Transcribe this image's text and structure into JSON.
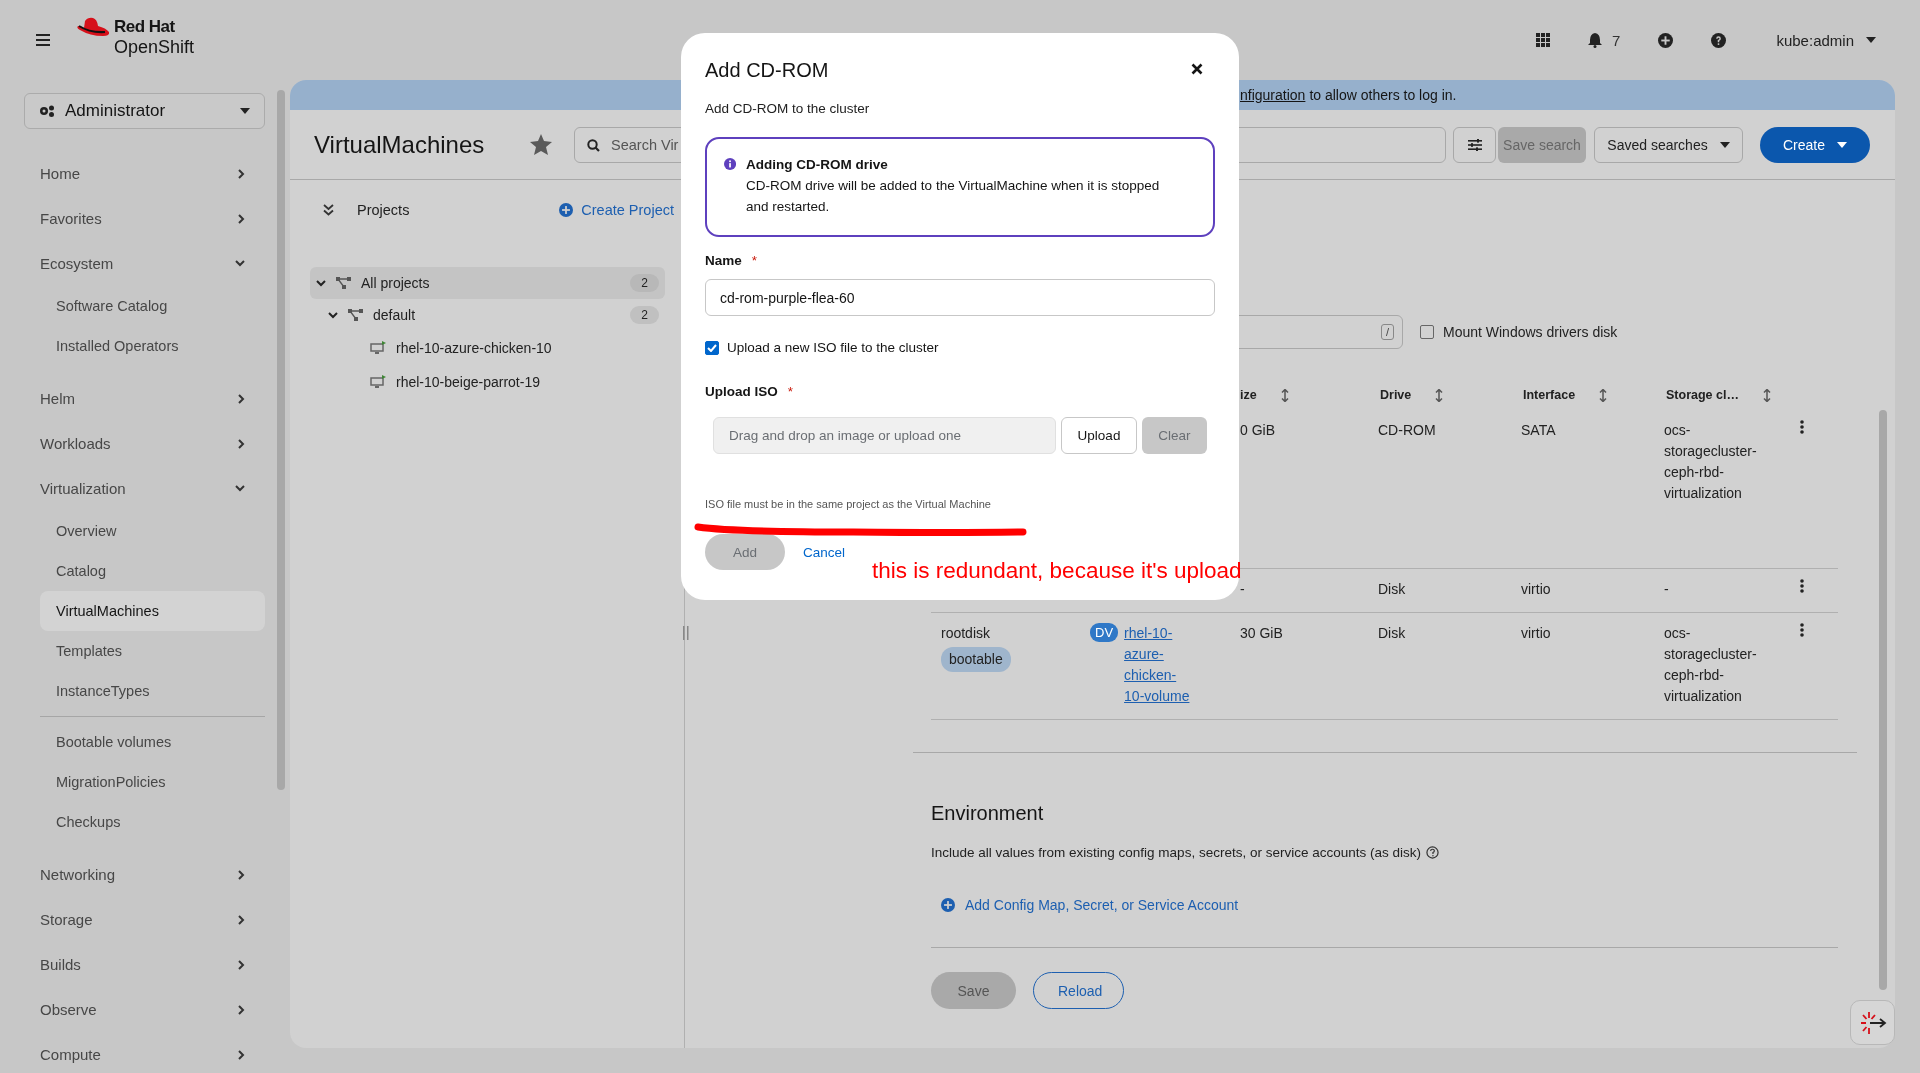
{
  "masthead": {
    "brand_line_1": "Red Hat",
    "brand_line_2": "OpenShift",
    "notifications_count": "7",
    "user": "kube:admin"
  },
  "perspective": {
    "label": "Administrator"
  },
  "nav": [
    {
      "label": "Home",
      "expanded": false
    },
    {
      "label": "Favorites",
      "expanded": false
    },
    {
      "label": "Ecosystem",
      "expanded": true,
      "children": [
        {
          "kind": "link",
          "label": "Software Catalog",
          "selected": false
        },
        {
          "kind": "link",
          "label": "Installed Operators",
          "selected": false
        }
      ]
    },
    {
      "label": "Helm",
      "expanded": false
    },
    {
      "label": "Workloads",
      "expanded": false
    },
    {
      "label": "Virtualization",
      "expanded": true,
      "children": [
        {
          "kind": "link",
          "label": "Overview",
          "selected": false
        },
        {
          "kind": "link",
          "label": "Catalog",
          "selected": false
        },
        {
          "kind": "link",
          "label": "VirtualMachines",
          "selected": true
        },
        {
          "kind": "link",
          "label": "Templates",
          "selected": false
        },
        {
          "kind": "link",
          "label": "InstanceTypes",
          "selected": false
        },
        {
          "kind": "divider"
        },
        {
          "kind": "link",
          "label": "Bootable volumes",
          "selected": false
        },
        {
          "kind": "link",
          "label": "MigrationPolicies",
          "selected": false
        },
        {
          "kind": "link",
          "label": "Checkups",
          "selected": false
        }
      ]
    },
    {
      "label": "Networking",
      "expanded": false
    },
    {
      "label": "Storage",
      "expanded": false
    },
    {
      "label": "Builds",
      "expanded": false
    },
    {
      "label": "Observe",
      "expanded": false
    },
    {
      "label": "Compute",
      "expanded": false
    }
  ],
  "banner": {
    "link": "nfiguration",
    "text": "to allow others to log in."
  },
  "page": {
    "title": "VirtualMachines",
    "search_placeholder": "Search Vir",
    "save_search": {
      "label": "Save search",
      "disabled": true
    },
    "saved_searches": "Saved searches",
    "create": "Create"
  },
  "projects": {
    "title": "Projects",
    "create_link": "Create Project",
    "tree": [
      {
        "label": "All projects",
        "count": "2",
        "selected": true,
        "expanded": true,
        "children": [
          {
            "label": "default",
            "count": "2",
            "selected": false,
            "expanded": true,
            "children": [
              {
                "label": "rhel-10-azure-chicken-10",
                "selected": false
              },
              {
                "label": "rhel-10-beige-parrot-19",
                "selected": false
              }
            ]
          }
        ]
      }
    ]
  },
  "disks": {
    "filter_key_hint": "/",
    "mount_windows_drivers": {
      "label": "Mount Windows drivers disk",
      "checked": false
    },
    "columns": [
      "ize",
      "Drive",
      "Interface",
      "Storage cl…"
    ],
    "rows": [
      {
        "size": "0 GiB",
        "drive": "CD-ROM",
        "interface": "SATA",
        "storage_class": "ocs-storagecluster-ceph-rbd-virtualization"
      },
      {
        "size": "-",
        "drive": "Disk",
        "interface": "virtio",
        "storage_class": "-"
      },
      {
        "name": "rootdisk",
        "badge": "bootable",
        "source_tag": "DV",
        "source": "rhel-10-azure-chicken-10-volume",
        "size": "30 GiB",
        "drive": "Disk",
        "interface": "virtio",
        "storage_class": "ocs-storagecluster-ceph-rbd-virtualization"
      }
    ]
  },
  "environment": {
    "title": "Environment",
    "description": "Include all values from existing config maps, secrets, or service accounts (as disk)",
    "add_link": "Add Config Map, Secret, or Service Account"
  },
  "actions": [
    {
      "label": "Save",
      "kind": "primary",
      "disabled": true
    },
    {
      "label": "Reload",
      "kind": "secondary",
      "disabled": false
    }
  ],
  "modal": {
    "title": "Add CD-ROM",
    "subtitle": "Add CD-ROM to the cluster",
    "alert": {
      "title": "Adding CD-ROM drive",
      "body": "CD-ROM drive will be added to the VirtualMachine when it is stopped and restarted."
    },
    "name": {
      "label": "Name",
      "required_mark": "*",
      "value": "cd-rom-purple-flea-60"
    },
    "upload_new": {
      "label": "Upload a new ISO file to the cluster",
      "checked": true
    },
    "upload": {
      "label": "Upload ISO",
      "required_mark": "*",
      "placeholder": "Drag and drop an image or upload one",
      "upload_button": "Upload",
      "clear_button": "Clear",
      "clear_disabled": true
    },
    "helper": "ISO file must be in the same project as the Virtual Machine",
    "buttons": [
      {
        "label": "Add",
        "kind": "primary",
        "disabled": true
      },
      {
        "label": "Cancel",
        "kind": "link",
        "disabled": false
      }
    ]
  },
  "annotation": {
    "text": "this is redundant, because it's upload"
  }
}
